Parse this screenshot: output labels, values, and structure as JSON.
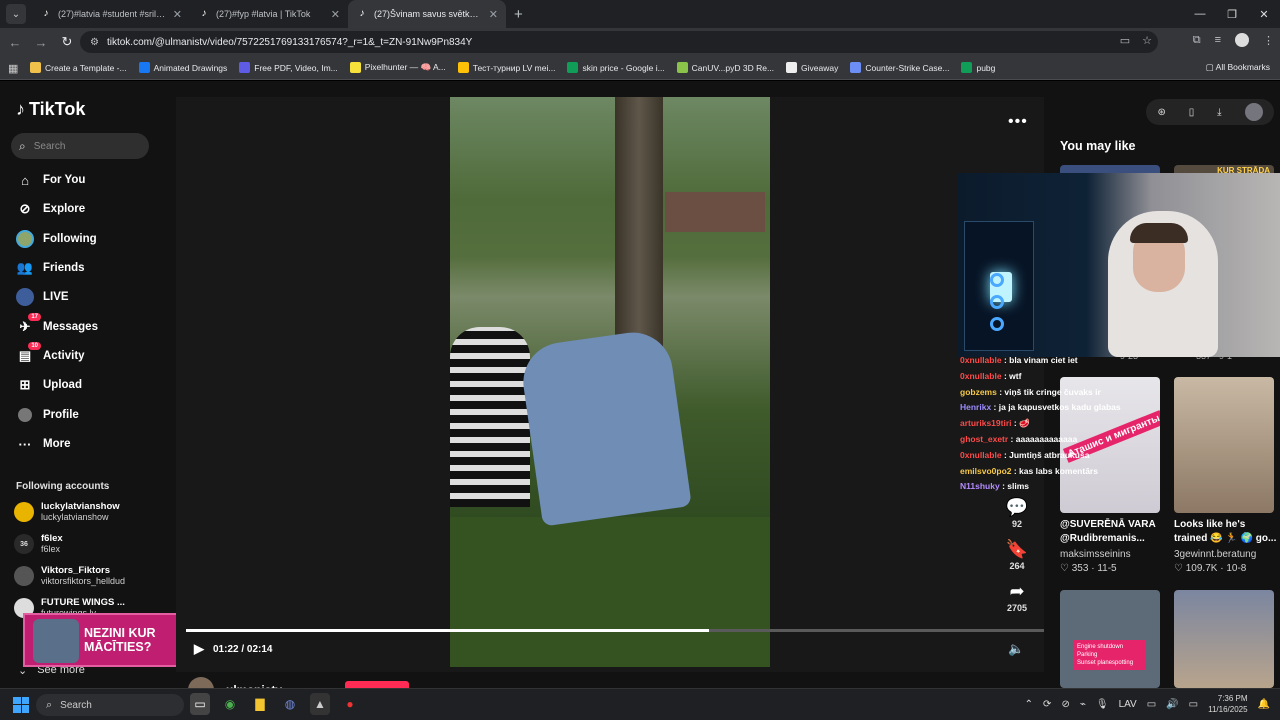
{
  "browser": {
    "tabs": [
      {
        "title": "(27)#latvia #student #srilankan",
        "active": false
      },
      {
        "title": "(27)#fyp #latvia | TikTok",
        "active": false
      },
      {
        "title": "(27)Švinam savus svētkus un tr",
        "active": true
      }
    ],
    "url": "tiktok.com/@ulmanistv/video/7572251769133176574?_r=1&_t=ZN-91Nw9Pn834Y",
    "bookmarks": [
      {
        "label": "Create a Template -...",
        "color": "#f0c14b"
      },
      {
        "label": "Animated Drawings",
        "color": "#1877f2"
      },
      {
        "label": "Free PDF, Video, Im...",
        "color": "#5e5ce6"
      },
      {
        "label": "Pixelhunter — 🧠 A...",
        "color": "#f7e13b"
      },
      {
        "label": "Тест-турнир LV mei...",
        "color": "#ffc107"
      },
      {
        "label": "skin price - Google i...",
        "color": "#0f9d58"
      },
      {
        "label": "CanUV...pyD 3D Re...",
        "color": "#8bc34a"
      },
      {
        "label": "Giveaway",
        "color": "#eeeeee"
      },
      {
        "label": "Counter-Strike Case...",
        "color": "#6c8ef5"
      },
      {
        "label": "pubg",
        "color": "#0f9d58"
      }
    ],
    "all_bookmarks": "All Bookmarks"
  },
  "sidebar": {
    "logo": "TikTok",
    "search_placeholder": "Search",
    "menu": [
      {
        "label": "For You",
        "icon": "home-icon"
      },
      {
        "label": "Explore",
        "icon": "compass-icon"
      },
      {
        "label": "Following",
        "icon": "following-avatar"
      },
      {
        "label": "Friends",
        "icon": "friends-icon"
      },
      {
        "label": "LIVE",
        "icon": "live-icon"
      },
      {
        "label": "Messages",
        "icon": "messages-icon",
        "badge": "17"
      },
      {
        "label": "Activity",
        "icon": "activity-icon",
        "badge": "10"
      },
      {
        "label": "Upload",
        "icon": "upload-icon"
      },
      {
        "label": "Profile",
        "icon": "profile-avatar"
      },
      {
        "label": "More",
        "icon": "more-icon"
      }
    ],
    "following_header": "Following accounts",
    "accounts": [
      {
        "name": "luckylatvianshow",
        "handle": "luckylatvianshow",
        "color": "#e9b400"
      },
      {
        "name": "f6lex",
        "handle": "f6lex",
        "color": "#444"
      },
      {
        "name": "Viktors_Fiktors",
        "handle": "viktorsfiktors_helldud",
        "color": "#666"
      },
      {
        "name": "FUTURE WINGS ...",
        "handle": "futurewings.lv",
        "color": "#ddd"
      }
    ],
    "see_more": "See more",
    "promo_text": "NEZINI KUR MĀCĪTIES?"
  },
  "player": {
    "time": "01:22 / 02:14",
    "progress": 0.61,
    "author": "ulmanistv",
    "actions": [
      {
        "name": "comment",
        "icon": "comment-icon",
        "count": "92"
      },
      {
        "name": "save",
        "icon": "bookmark-icon",
        "count": "264"
      },
      {
        "name": "share",
        "icon": "share-icon",
        "count": "2705"
      }
    ]
  },
  "chat": [
    {
      "user": "0xnullable",
      "msg": "bla vinam ciet iet",
      "color": "#ff4a4a"
    },
    {
      "user": "0xnullable",
      "msg": "wtf",
      "color": "#ff4a4a"
    },
    {
      "user": "gobzems",
      "msg": "viņš tik cringe čuvaks ir",
      "color": "#f7c948"
    },
    {
      "user": "Henrikx",
      "msg": "ja ja kapusvetkos kadu glabas",
      "color": "#9b8cff"
    },
    {
      "user": "arturiks19tiri",
      "msg": "🥩",
      "color": "#ff4a4a"
    },
    {
      "user": "ghost_exetr",
      "msg": "aaaaaaaaaaaaa",
      "color": "#ff4a4a"
    },
    {
      "user": "0xnullable",
      "msg": "Jumtiņš atbraukuša",
      "color": "#ff4a4a"
    },
    {
      "user": "emilsvo0po2",
      "msg": "kas labs komentārs",
      "color": "#f7c948"
    },
    {
      "user": "N11shuky",
      "msg": "slims",
      "color": "#b48cff"
    }
  ],
  "right": {
    "heading": "You may like",
    "top_captions": [
      "9-23",
      "337 · 9-1"
    ],
    "cards": [
      {
        "caption": "@SUVERĒNĀ VARA @Rudibremanis...",
        "user": "maksimsseinins",
        "likes": "353",
        "date": "11-5"
      },
      {
        "caption": "Looks like he's trained 😂 🏃 🌍 go...",
        "user": "3gewinnt.beratung",
        "likes": "109.7K",
        "date": "10-8"
      }
    ],
    "banner_text": "Аташис и мигранты",
    "store_sign": "KUR STRĀDA",
    "engine_lines": [
      "Engine shutdown",
      "Parking",
      "Sunset planespotting"
    ]
  },
  "taskbar": {
    "search_placeholder": "Search",
    "lang": "LAV",
    "time": "7:36 PM",
    "date": "11/16/2025"
  },
  "colors": {
    "accent": "#fe2c55",
    "bg": "#121212"
  }
}
